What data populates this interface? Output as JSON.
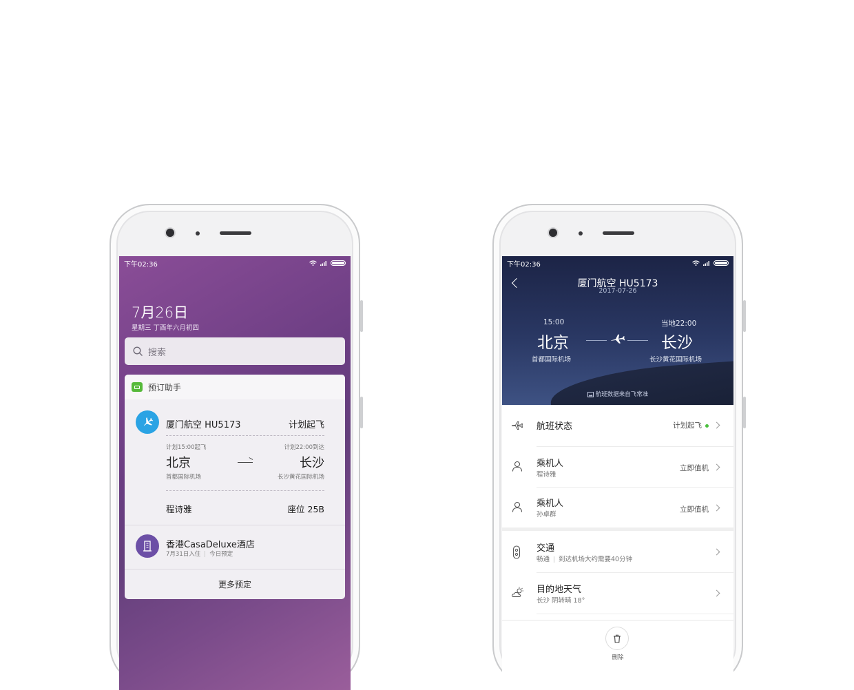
{
  "status_bar": {
    "time": "下午02:36"
  },
  "left_screen": {
    "date": "7月26日",
    "date_sub": "星期三 丁酉年六月初四",
    "search_placeholder": "搜索",
    "card": {
      "title": "预订助手",
      "flight": {
        "title": "厦门航空 HU5173",
        "status": "计划起飞",
        "dep_note": "计划15:00起飞",
        "arr_note": "计划22:00到达",
        "dep_city": "北京",
        "arr_city": "长沙",
        "dep_airport": "首都国际机场",
        "arr_airport": "长沙黄花国际机场",
        "passenger": "程诗雅",
        "seat": "座位 25B"
      },
      "hotel": {
        "title": "香港CasaDeluxe酒店",
        "checkin": "7月31日入住",
        "booking": "今日预定"
      },
      "more": "更多预定"
    },
    "colors": {
      "bg_start": "#8a4d97",
      "bg_end": "#643f7c",
      "flight_icon": "#2aa3e4",
      "hotel_icon": "#6c4fa6",
      "helper_icon": "#56b93a"
    }
  },
  "right_screen": {
    "header": {
      "title": "厦门航空 HU5173",
      "date": "2017-07-26",
      "dep_time": "15:00",
      "arr_time": "当地22:00",
      "dep_city": "北京",
      "arr_city": "长沙",
      "dep_airport": "首都国际机场",
      "arr_airport": "长沙黄花国际机场",
      "source_note": "航班数据来自飞常准"
    },
    "rows": [
      {
        "title": "航班状态",
        "sub": "",
        "right": "计划起飞",
        "icon": "plane-icon"
      },
      {
        "title": "乘机人",
        "sub": "程诗雅",
        "right": "立即值机",
        "icon": "person-icon"
      },
      {
        "title": "乘机人",
        "sub": "孙卓群",
        "right": "立即值机",
        "icon": "person-icon"
      },
      {
        "title": "交通",
        "sub": "畅通",
        "sub2": "到达机场大约需要40分钟",
        "right": "",
        "icon": "traffic-light-icon"
      },
      {
        "title": "目的地天气",
        "sub": "长沙 阴转晴 18°",
        "right": "",
        "icon": "weather-icon"
      }
    ],
    "delete_label": "删除",
    "colors": {
      "header_top": "#1c2446",
      "header_bottom": "#3e5283",
      "status_dot": "#4cbf3f"
    }
  }
}
